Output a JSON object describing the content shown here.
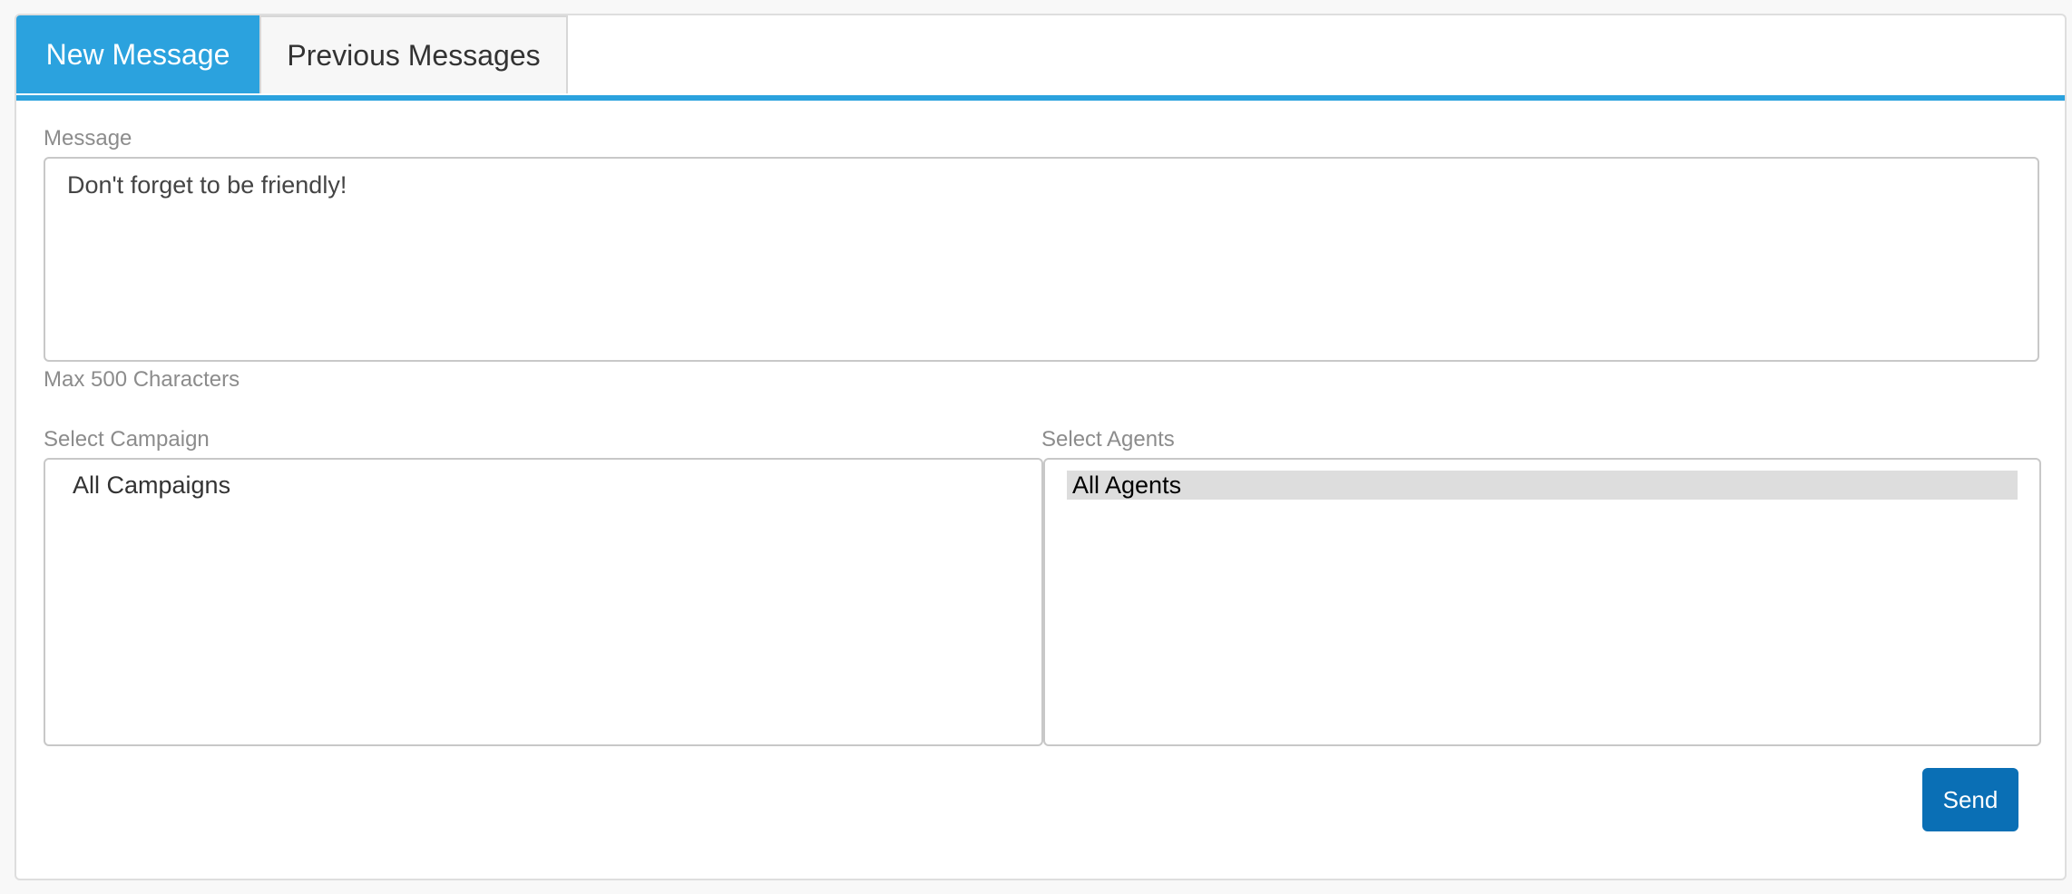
{
  "tabs": [
    {
      "label": "New Message",
      "active": true
    },
    {
      "label": "Previous Messages",
      "active": false
    }
  ],
  "message": {
    "label": "Message",
    "value": "Don't forget to be friendly!",
    "hint": "Max 500 Characters"
  },
  "campaign": {
    "label": "Select Campaign",
    "options": [
      {
        "label": "All Campaigns",
        "selected": false
      }
    ]
  },
  "agents": {
    "label": "Select Agents",
    "options": [
      {
        "label": "All Agents",
        "selected": true
      }
    ]
  },
  "actions": {
    "send_label": "Send"
  },
  "colors": {
    "tab_active_bg": "#2ba2de",
    "send_button_bg": "#0a6fb5",
    "selected_option_bg": "#dddddd"
  }
}
